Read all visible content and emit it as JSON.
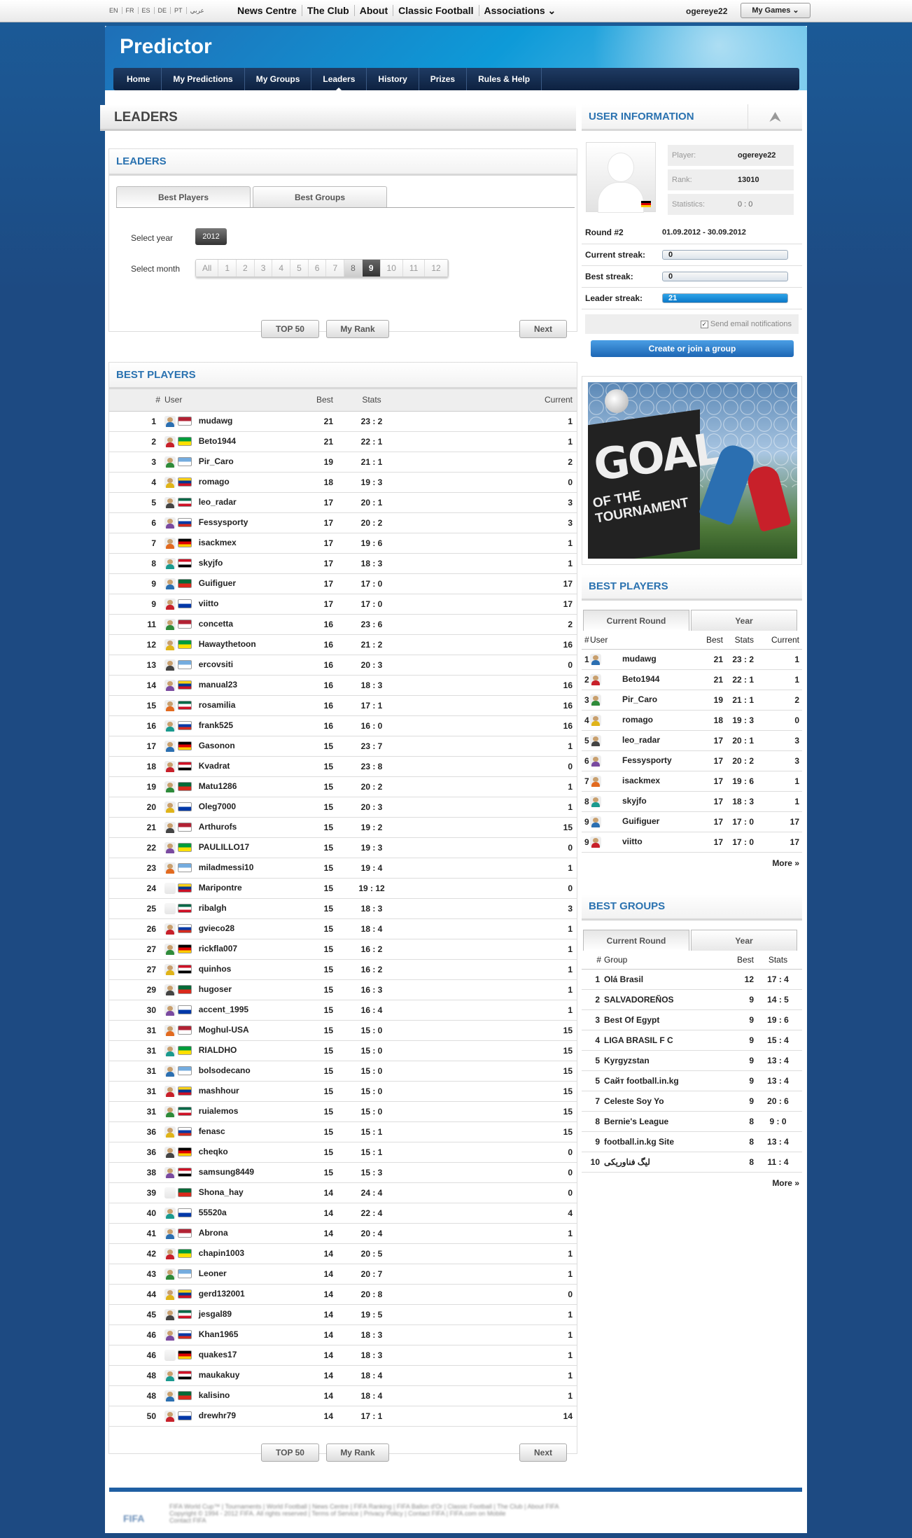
{
  "topbar": {
    "languages": [
      "EN",
      "FR",
      "ES",
      "DE",
      "PT",
      "عربي"
    ],
    "nav": [
      "News Centre",
      "The Club",
      "About",
      "Classic Football",
      "Associations ⌄"
    ],
    "username": "ogereye22",
    "my_games": "My Games ⌄"
  },
  "header": {
    "title": "Predictor",
    "tabs": [
      "Home",
      "My Predictions",
      "My Groups",
      "Leaders",
      "History",
      "Prizes",
      "Rules & Help"
    ],
    "active_tab": "Leaders"
  },
  "page_title": "LEADERS",
  "leaders_box": {
    "title": "LEADERS",
    "tabs": [
      "Best Players",
      "Best Groups"
    ],
    "select_year_label": "Select year",
    "year": "2012",
    "select_month_label": "Select month",
    "months": [
      "All",
      "1",
      "2",
      "3",
      "4",
      "5",
      "6",
      "7",
      "8",
      "9",
      "10",
      "11",
      "12"
    ],
    "selected_month": "9"
  },
  "pager": {
    "top50": "TOP 50",
    "my_rank": "My Rank",
    "next": "Next"
  },
  "best_players": {
    "title": "BEST PLAYERS",
    "headers": {
      "rank": "#",
      "user": "User",
      "best": "Best",
      "stats": "Stats",
      "current": "Current"
    },
    "rows": [
      [
        "1",
        "mudawg",
        "21",
        "23 : 2",
        "1"
      ],
      [
        "2",
        "Beto1944",
        "21",
        "22 : 1",
        "1"
      ],
      [
        "3",
        "Pir_Caro",
        "19",
        "21 : 1",
        "2"
      ],
      [
        "4",
        "romago",
        "18",
        "19 : 3",
        "0"
      ],
      [
        "5",
        "leo_radar",
        "17",
        "20 : 1",
        "3"
      ],
      [
        "6",
        "Fessysporty",
        "17",
        "20 : 2",
        "3"
      ],
      [
        "7",
        "isackmex",
        "17",
        "19 : 6",
        "1"
      ],
      [
        "8",
        "skyjfo",
        "17",
        "18 : 3",
        "1"
      ],
      [
        "9",
        "Guifiguer",
        "17",
        "17 : 0",
        "17"
      ],
      [
        "9",
        "viitto",
        "17",
        "17 : 0",
        "17"
      ],
      [
        "11",
        "concetta",
        "16",
        "23 : 6",
        "2"
      ],
      [
        "12",
        "Hawaythetoon",
        "16",
        "21 : 2",
        "16"
      ],
      [
        "13",
        "ercovsiti",
        "16",
        "20 : 3",
        "0"
      ],
      [
        "14",
        "manual23",
        "16",
        "18 : 3",
        "16"
      ],
      [
        "15",
        "rosamilia",
        "16",
        "17 : 1",
        "16"
      ],
      [
        "16",
        "frank525",
        "16",
        "16 : 0",
        "16"
      ],
      [
        "17",
        "Gasonon",
        "15",
        "23 : 7",
        "1"
      ],
      [
        "18",
        "Kvadrat",
        "15",
        "23 : 8",
        "0"
      ],
      [
        "19",
        "Matu1286",
        "15",
        "20 : 2",
        "1"
      ],
      [
        "20",
        "Oleg7000",
        "15",
        "20 : 3",
        "1"
      ],
      [
        "21",
        "Arthurofs",
        "15",
        "19 : 2",
        "15"
      ],
      [
        "22",
        "PAULILLO17",
        "15",
        "19 : 3",
        "0"
      ],
      [
        "23",
        "miladmessi10",
        "15",
        "19 : 4",
        "1"
      ],
      [
        "24",
        "Maripontre",
        "15",
        "19 : 12",
        "0"
      ],
      [
        "25",
        "ribalgh",
        "15",
        "18 : 3",
        "3"
      ],
      [
        "26",
        "gvieco28",
        "15",
        "18 : 4",
        "1"
      ],
      [
        "27",
        "rickfla007",
        "15",
        "16 : 2",
        "1"
      ],
      [
        "27",
        "quinhos",
        "15",
        "16 : 2",
        "1"
      ],
      [
        "29",
        "hugoser",
        "15",
        "16 : 3",
        "1"
      ],
      [
        "30",
        "accent_1995",
        "15",
        "16 : 4",
        "1"
      ],
      [
        "31",
        "Moghul-USA",
        "15",
        "15 : 0",
        "15"
      ],
      [
        "31",
        "RIALDHO",
        "15",
        "15 : 0",
        "15"
      ],
      [
        "31",
        "bolsodecano",
        "15",
        "15 : 0",
        "15"
      ],
      [
        "31",
        "mashhour",
        "15",
        "15 : 0",
        "15"
      ],
      [
        "31",
        "ruialemos",
        "15",
        "15 : 0",
        "15"
      ],
      [
        "36",
        "fenasc",
        "15",
        "15 : 1",
        "15"
      ],
      [
        "36",
        "cheqko",
        "15",
        "15 : 1",
        "0"
      ],
      [
        "38",
        "samsung8449",
        "15",
        "15 : 3",
        "0"
      ],
      [
        "39",
        "Shona_hay",
        "14",
        "24 : 4",
        "0"
      ],
      [
        "40",
        "55520a",
        "14",
        "22 : 4",
        "4"
      ],
      [
        "41",
        "Abrona",
        "14",
        "20 : 4",
        "1"
      ],
      [
        "42",
        "chapin1003",
        "14",
        "20 : 5",
        "1"
      ],
      [
        "43",
        "Leoner",
        "14",
        "20 : 7",
        "1"
      ],
      [
        "44",
        "gerd132001",
        "14",
        "20 : 8",
        "0"
      ],
      [
        "45",
        "jesgal89",
        "14",
        "19 : 5",
        "1"
      ],
      [
        "46",
        "Khan1965",
        "14",
        "18 : 3",
        "1"
      ],
      [
        "46",
        "quakes17",
        "14",
        "18 : 3",
        "1"
      ],
      [
        "48",
        "maukakuy",
        "14",
        "18 : 4",
        "1"
      ],
      [
        "48",
        "kalisino",
        "14",
        "18 : 4",
        "1"
      ],
      [
        "50",
        "drewhr79",
        "14",
        "17 : 1",
        "14"
      ]
    ]
  },
  "user_info": {
    "title": "USER INFORMATION",
    "player_label": "Player:",
    "player": "ogereye22",
    "rank_label": "Rank:",
    "rank": "13010",
    "stats_label": "Statistics:",
    "stats": "0 : 0",
    "round_label": "Round #2",
    "round_dates": "01.09.2012 - 30.09.2012",
    "current_streak_label": "Current streak:",
    "current_streak": "0",
    "best_streak_label": "Best streak:",
    "best_streak": "0",
    "leader_streak_label": "Leader streak:",
    "leader_streak": "21",
    "email_notifications": "Send email notifications",
    "create_group": "Create or join a group"
  },
  "banner": {
    "line1": "GOAL",
    "line2": "OF THE TOURNAMENT"
  },
  "side_players": {
    "title": "BEST PLAYERS",
    "tabs": [
      "Current Round",
      "Year"
    ],
    "headers": {
      "rank": "#",
      "user": "User",
      "best": "Best",
      "stats": "Stats",
      "current": "Current"
    },
    "rows": [
      [
        "1",
        "mudawg",
        "21",
        "23 : 2",
        "1"
      ],
      [
        "2",
        "Beto1944",
        "21",
        "22 : 1",
        "1"
      ],
      [
        "3",
        "Pir_Caro",
        "19",
        "21 : 1",
        "2"
      ],
      [
        "4",
        "romago",
        "18",
        "19 : 3",
        "0"
      ],
      [
        "5",
        "leo_radar",
        "17",
        "20 : 1",
        "3"
      ],
      [
        "6",
        "Fessysporty",
        "17",
        "20 : 2",
        "3"
      ],
      [
        "7",
        "isackmex",
        "17",
        "19 : 6",
        "1"
      ],
      [
        "8",
        "skyjfo",
        "17",
        "18 : 3",
        "1"
      ],
      [
        "9",
        "Guifiguer",
        "17",
        "17 : 0",
        "17"
      ],
      [
        "9",
        "viitto",
        "17",
        "17 : 0",
        "17"
      ]
    ],
    "more": "More »"
  },
  "side_groups": {
    "title": "BEST GROUPS",
    "tabs": [
      "Current Round",
      "Year"
    ],
    "headers": {
      "rank": "#",
      "group": "Group",
      "best": "Best",
      "stats": "Stats"
    },
    "rows": [
      [
        "1",
        "Olá Brasil",
        "12",
        "17 : 4"
      ],
      [
        "2",
        "SALVADOREÑOS",
        "9",
        "14 : 5"
      ],
      [
        "3",
        "Best Of Egypt",
        "9",
        "19 : 6"
      ],
      [
        "4",
        "LIGA BRASIL F C",
        "9",
        "15 : 4"
      ],
      [
        "5",
        "Kyrgyzstan",
        "9",
        "13 : 4"
      ],
      [
        "5",
        "Сайт football.in.kg",
        "9",
        "13 : 4"
      ],
      [
        "7",
        "Celeste Soy Yo",
        "9",
        "20 : 6"
      ],
      [
        "8",
        "Bernie's League",
        "8",
        "9 : 0"
      ],
      [
        "9",
        "football.in.kg Site",
        "8",
        "13 : 4"
      ],
      [
        "10",
        "لیگ فناوریکی",
        "8",
        "11 : 4"
      ]
    ],
    "more": "More »"
  },
  "colors": {
    "accent": "#2a72b0",
    "header": "#0e8fd3",
    "nav": "#0d2140",
    "footer_bar": "#1f5fa3"
  }
}
